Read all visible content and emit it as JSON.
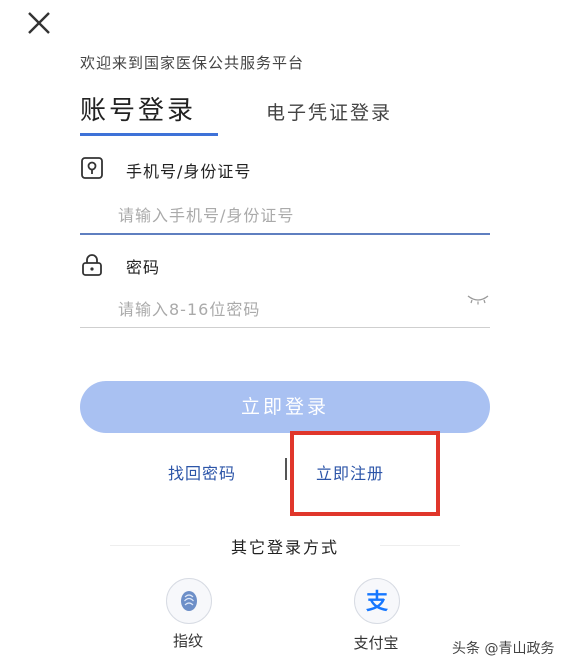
{
  "header": {
    "welcome_text": "欢迎来到国家医保公共服务平台"
  },
  "tabs": [
    {
      "label": "账号登录",
      "active": true
    },
    {
      "label": "电子凭证登录",
      "active": false
    }
  ],
  "fields": {
    "account": {
      "label": "手机号/身份证号",
      "placeholder": "请输入手机号/身份证号",
      "value": "",
      "icon": "id-card-icon"
    },
    "password": {
      "label": "密码",
      "placeholder": "请输入8-16位密码",
      "value": "",
      "icon": "lock-icon",
      "toggle_icon": "eye-closed-icon"
    }
  },
  "login_button": {
    "label": "立即登录",
    "color": "#a9c1f2"
  },
  "links": {
    "forgot_password": "找回密码",
    "register": "立即注册"
  },
  "other_login": {
    "title": "其它登录方式",
    "methods": [
      {
        "label": "指纹",
        "icon": "fingerprint-icon"
      },
      {
        "label": "支付宝",
        "icon": "alipay-icon"
      }
    ]
  },
  "watermark": "头条 @青山政务",
  "colors": {
    "accent": "#3e72d8",
    "link": "#2c55a8",
    "highlight": "#e0362b",
    "alipay": "#1677ff"
  }
}
